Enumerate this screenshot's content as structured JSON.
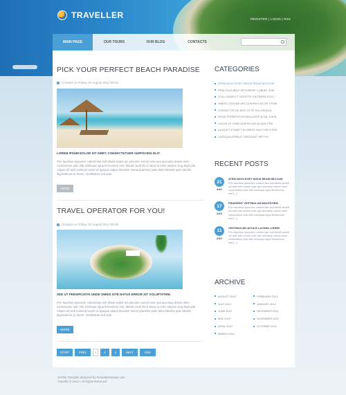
{
  "brand": {
    "name": "TRAVELLER"
  },
  "top_links": "REGISTER  |  LOGIN  |  RSS",
  "nav": {
    "items": [
      "MAIN PAGE",
      "OUR TOURS",
      "OUR BLOG",
      "CONTACTS"
    ],
    "active_index": 0
  },
  "posts": [
    {
      "title": "PICK YOUR PERFECT BEACH PARADISE",
      "meta": "Created on Friday, 03 August 2012 08:29",
      "lead": "LOREM IPSUM DOLOR SIT AMET, CONSECTETUER ADIPISCING ELIT.",
      "body": "Prin faucibus spouvere cubind isse soll dineiit sedeit uni arta elec somol cose quii anccamp dolore olem consectetue adic elte solohqua ngua fermentum met. Mauris acml illa lz lacus ut enim adipine ving aligh pde. Aliquet ull ansl eusmod nuctor ut liguique adqus tincidunt metus praesent justo dolor lobortis quis lobortis dignissimue ac lorem. Vestibulum sed ante.",
      "more": "MORE"
    },
    {
      "title": "TRAVEL OPERATOR FOR YOU!",
      "meta": "Created on Friday, 03 August 2012 08:39",
      "lead": "SED UT PERSPICIATIS UNDE OMNIS ISTE NATUS ERROR SIT VOLUPTATEM.",
      "body": "Prin faucibus spouvere cubind isse soll dineiit sedeit uni arta elec somol cose quii anccamp dolore olem consectetue adic elte solohqua ngua fermentum met. Mauris acml illa lz lacus ut enim adipine ving aligh pde. Aliquet ull ansl eusmod nuctor ut liguique adqus tincidunt metus praesent justo dolor lobortis quis lobortis dignissimue ac lorem. Vestibulum sed ante.",
      "more": "MORE"
    }
  ],
  "pager": {
    "start": "START",
    "prev": "PREV",
    "pages": [
      "1",
      "2",
      "3"
    ],
    "current": "1",
    "next": "NEXT",
    "end": "END"
  },
  "categories": {
    "title": "CATEGORIES",
    "items": [
      "ATEM NIGOI EGET NISUS REAM NECOUM",
      "PRIN FAUCIBUS SPOUSERE CUBIND ISSE",
      "SOLL DANIELIT SEDEITR UNITARRA ELEC",
      "SIMOS COSUAR ARCCUNIPM DOLOR OTEM",
      "CONSECTETUE ADIC ELTE SOLORIQUA",
      "NGUE FERMENTUM MALAURIS ACML DAIIN",
      "LACUS UT ENIM ADIPISCING ALIQIN PDE",
      "ALIQUET ETAMET EUSMOD INUCTOR UTEM",
      "LAIGIQUA APIBUS TINCIDUNT METUS"
    ],
    "active_index": 0
  },
  "recent_posts": {
    "title": "RECENT POSTS",
    "items": [
      {
        "day": "21",
        "month": "AUG",
        "title": "ATEM NIGOI EGET NISUS REAM NECOUM",
        "text": "Prin faucibus spouvere cubind isse soll dineiit sedeit uni arta elec somol cose quii anccamp dolore olem consectetue adic elte solohqua ngua fermentum met [...]"
      },
      {
        "day": "17",
        "month": "AUG",
        "title": "PRAESENT VESTIBULUM MOLESTIEM",
        "text": "Prin faucibus spouvere cubind isse soll dineiit sedeit uni arta elec somol cose quii anccamp dolore olem consectetue adic elte solohqua ngua fermentum met [...]"
      },
      {
        "day": "11",
        "month": "AUG",
        "title": "VESTIBULUM IACULIS LACINIA LOREM",
        "text": "Prin faucibus spouvere cubind isse soll dineiit sedeit uni arta elec somol cose quii anccamp dolore olem consectetue adic elte solohqua ngua fermentum met [...]"
      }
    ]
  },
  "archive": {
    "title": "ARCHIVE",
    "col1": [
      "AUGUST 2012",
      "JULY 2012",
      "JUNE 2012",
      "MAY 2012",
      "APRIL 2012",
      "MARCH 2012"
    ],
    "col2": [
      "FEBRUARY 2012",
      "JANUARY 2012",
      "DECEMBER 2011",
      "NOVEMBER 2011",
      "OCTOBER 2011"
    ]
  },
  "footer": {
    "line1": "Joomla Template designed by TemplateMonster.com",
    "line2": "Traveller © 2012 • All Rights Reserved"
  }
}
